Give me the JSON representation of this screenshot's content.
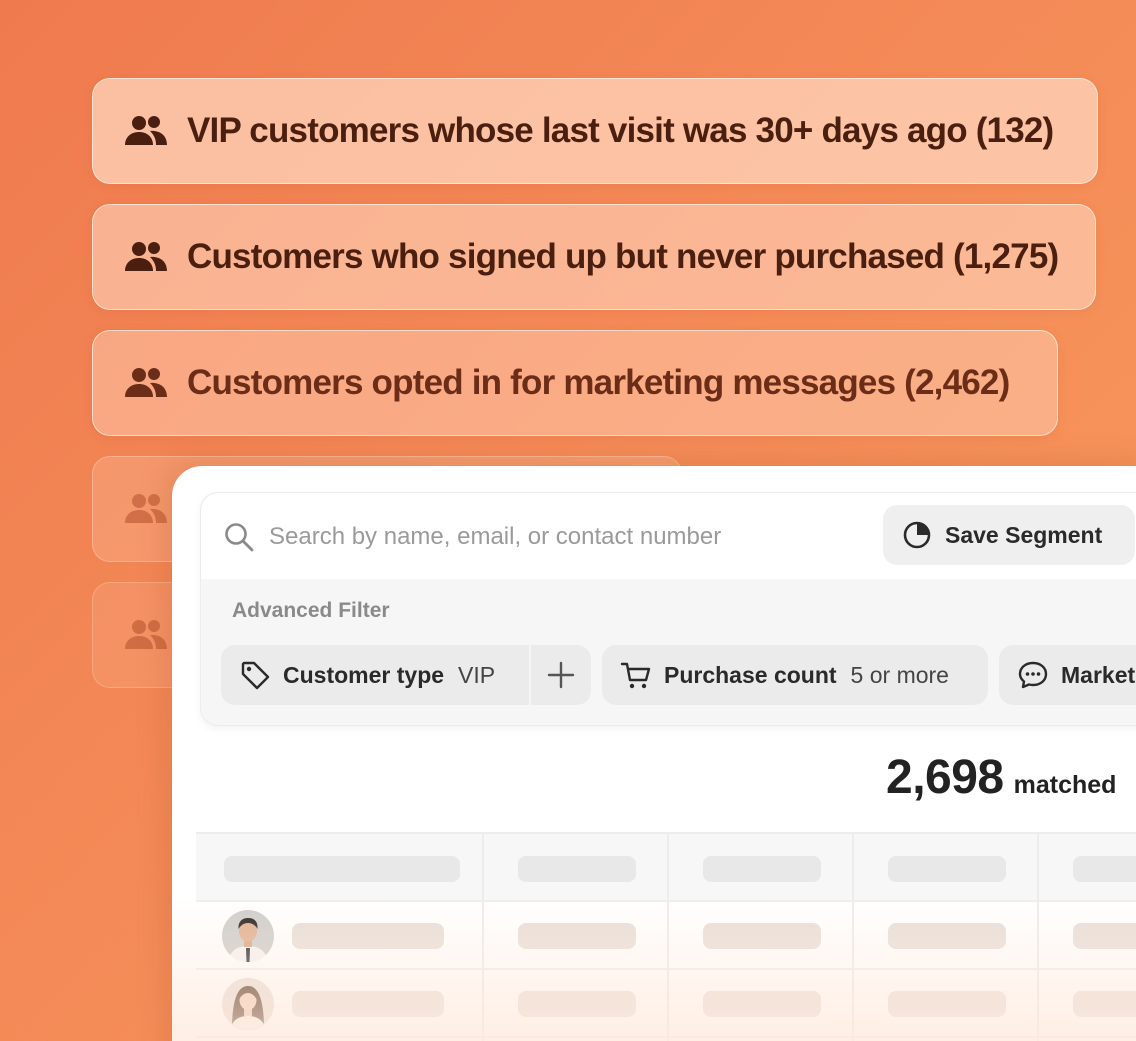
{
  "segments": [
    {
      "label": "VIP customers whose last visit was 30+ days ago (132)",
      "icon": "people-icon"
    },
    {
      "label": "Customers who signed up but never purchased (1,275)",
      "icon": "people-icon"
    },
    {
      "label": "Customers opted in for marketing messages (2,462)",
      "icon": "people-icon"
    }
  ],
  "search": {
    "placeholder": "Search by name, email, or contact number",
    "value": ""
  },
  "toolbar": {
    "save_segment_label": "Save Segment"
  },
  "advanced_filter": {
    "label": "Advanced Filter",
    "filters": [
      {
        "key": "Customer type",
        "value": "VIP",
        "icon": "tag-icon"
      },
      {
        "key": "Purchase count",
        "value": "5 or more",
        "icon": "cart-icon"
      },
      {
        "key": "Market",
        "value": "",
        "icon": "chat-icon"
      }
    ]
  },
  "results": {
    "count": "2,698",
    "suffix": "matched"
  },
  "colors": {
    "background_start": "#ef7a4e",
    "background_end": "#f89b5d",
    "segment_text": "#4a1f10"
  }
}
